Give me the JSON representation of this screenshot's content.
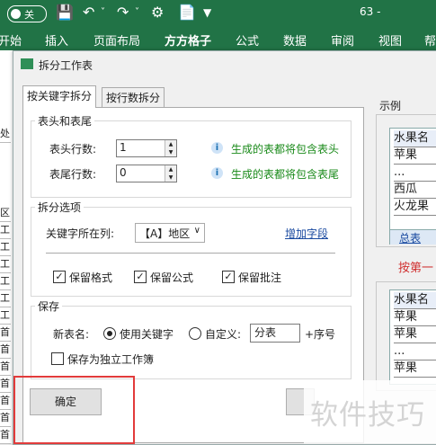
{
  "titlebar": {
    "autosave_label": "关",
    "doc_title": "63 -"
  },
  "ribbon": {
    "tabs": [
      "开始",
      "插入",
      "页面布局",
      "方方格子",
      "公式",
      "数据",
      "审阅",
      "视图",
      "帮"
    ]
  },
  "sheet_strip": {
    "cells": [
      "处",
      "区",
      "工",
      "工",
      "工",
      "工",
      "工",
      "工",
      "首",
      "首",
      "首",
      "首",
      "首",
      "首",
      "首"
    ]
  },
  "dialog": {
    "title": "拆分工作表",
    "tabs": [
      "按关键字拆分",
      "按行数拆分"
    ],
    "header_footer": {
      "title": "表头和表尾",
      "header_rows_label": "表头行数:",
      "header_rows_value": "1",
      "header_hint": "生成的表都将包含表头",
      "footer_rows_label": "表尾行数:",
      "footer_rows_value": "0",
      "footer_hint": "生成的表都将包含表尾"
    },
    "split_options": {
      "title": "拆分选项",
      "column_label": "关键字所在列:",
      "column_value": "【A】地区",
      "add_field_link": "增加字段",
      "keep_format": "保留格式",
      "keep_formula": "保留公式",
      "keep_comment": "保留批注"
    },
    "save": {
      "title": "保存",
      "new_name_label": "新表名:",
      "use_keyword": "使用关键字",
      "custom_label": "自定义:",
      "custom_value": "分表",
      "suffix": "+序号",
      "save_as_workbook": "保存为独立工作簿"
    },
    "ok_button": "确定",
    "example": {
      "title": "示例",
      "table1": [
        "水果名",
        "苹果",
        "...",
        "西瓜",
        "火龙果"
      ],
      "sheet_tab": "总表",
      "caption": "按第一",
      "table2": [
        "水果名",
        "苹果",
        "苹果",
        "...",
        "苹果"
      ]
    }
  },
  "watermark": "软件技巧"
}
